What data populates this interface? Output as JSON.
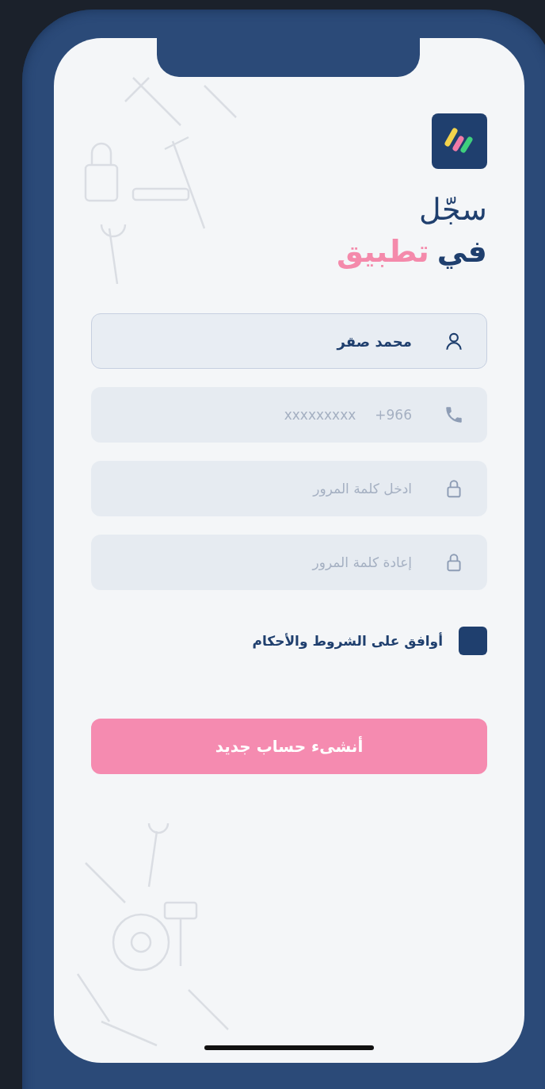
{
  "title": {
    "line1": "سجّل",
    "line2_prefix": "في",
    "line2_highlight": "تطبيق"
  },
  "fields": [
    {
      "kind": "name",
      "value": "محمد صقر",
      "focused": true
    },
    {
      "kind": "phone",
      "prefix": "+966",
      "placeholder": "xxxxxxxxx",
      "focused": false
    },
    {
      "kind": "password",
      "placeholder": "ادخل كلمة المرور",
      "focused": false
    },
    {
      "kind": "password",
      "placeholder": "إعادة كلمة المرور",
      "focused": false
    }
  ],
  "terms": {
    "label": "أوافق على الشروط والأحكام",
    "checked": false
  },
  "submit": {
    "label": "أنشىء حساب جديد"
  }
}
